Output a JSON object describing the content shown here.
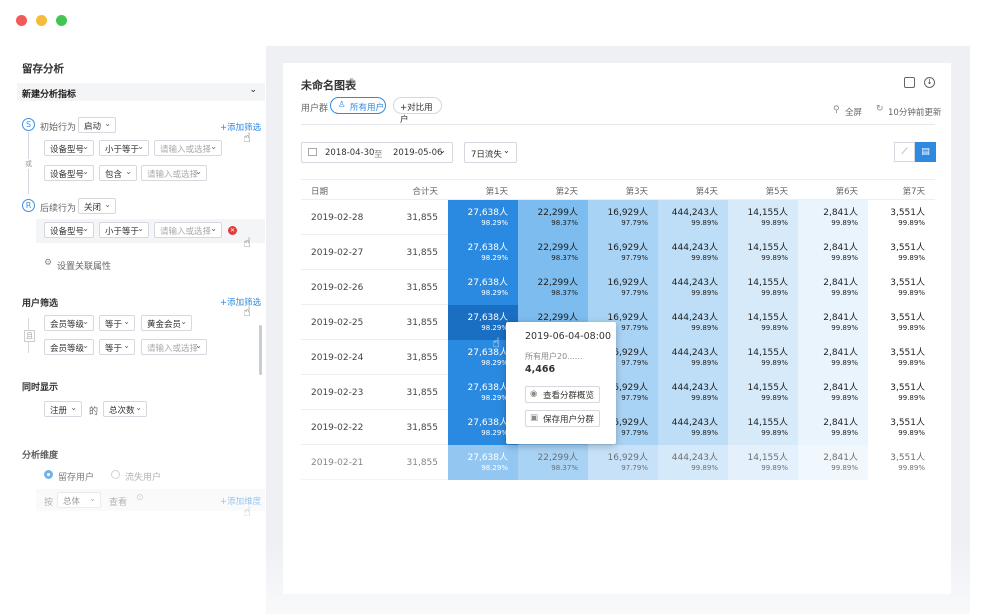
{
  "left": {
    "title": "留存分析",
    "metrics_header": "新建分析指标",
    "initial_label": "初始行为",
    "initial_value": "启动",
    "add_filter": "+添加筛选",
    "or": "或",
    "f1_field": "设备型号",
    "f1_op": "小于等于",
    "f1_ph": "请输入或选择",
    "f2_field": "设备型号",
    "f2_op": "包含",
    "f2_ph": "请输入或选择",
    "followup_label": "后续行为",
    "followup_value": "关闭",
    "f3_field": "设备型号",
    "f3_op": "小于等于",
    "f3_ph": "请输入或选择",
    "assoc": "设置关联属性",
    "user_filter": "用户筛选",
    "add_filter2": "+添加筛选",
    "and": "且",
    "u1_field": "会员等级",
    "u1_op": "等于",
    "u1_val": "黄金会员",
    "u2_field": "会员等级",
    "u2_op": "等于",
    "u2_ph": "请输入或选择",
    "simul": "同时显示",
    "s_field": "注册",
    "s_of": "的",
    "s_val": "总次数",
    "dim": "分析维度",
    "dim_opt1": "留存用户",
    "dim_opt2": "流失用户",
    "by": "按",
    "by_val": "总体",
    "view": "查看",
    "add_dim": "+添加维度"
  },
  "chart": {
    "title": "未命名图表",
    "group_label": "用户群",
    "group_all": "所有用户",
    "group_compare": "+对比用户",
    "fullscreen": "全屏",
    "updated": "10分钟前更新",
    "date_from": "2018-04-30",
    "date_to": "2019-05-06",
    "date_sep": "至",
    "period": "7日流失"
  },
  "table": {
    "headers": [
      "日期",
      "合计天",
      "第1天",
      "第2天",
      "第3天",
      "第4天",
      "第5天",
      "第6天",
      "第7天"
    ],
    "rows": [
      {
        "date": "2019-02-28",
        "total": "31,855"
      },
      {
        "date": "2019-02-27",
        "total": "31,855"
      },
      {
        "date": "2019-02-26",
        "total": "31,855"
      },
      {
        "date": "2019-02-25",
        "total": "31,855"
      },
      {
        "date": "2019-02-24",
        "total": "31,855"
      },
      {
        "date": "2019-02-23",
        "total": "31,855"
      },
      {
        "date": "2019-02-22",
        "total": "31,855"
      },
      {
        "date": "2019-02-21",
        "total": "31,855"
      }
    ],
    "cols": [
      {
        "v": "27,638人",
        "p": "98.29%",
        "bg": "#2a8ae2",
        "fg": "#ffffff"
      },
      {
        "v": "22,299人",
        "p": "98.37%",
        "bg": "#7cbcee",
        "fg": "#222222"
      },
      {
        "v": "16,929人",
        "p": "97.79%",
        "bg": "#a9d3f4",
        "fg": "#222222"
      },
      {
        "v": "444,243人",
        "p": "99.89%",
        "bg": "#bddef6",
        "fg": "#222222"
      },
      {
        "v": "14,155人",
        "p": "99.89%",
        "bg": "#d6eafa",
        "fg": "#222222"
      },
      {
        "v": "2,841人",
        "p": "99.89%",
        "bg": "#e9f4fc",
        "fg": "#222222"
      },
      {
        "v": "3,551人",
        "p": "99.89%",
        "bg": "#ffffff",
        "fg": "#222222"
      }
    ]
  },
  "popup": {
    "time": "2019-06-04-08:00",
    "label": "所有用户20......",
    "value": "4,466",
    "btn1": "查看分群概览",
    "btn2": "保存用户分群"
  }
}
